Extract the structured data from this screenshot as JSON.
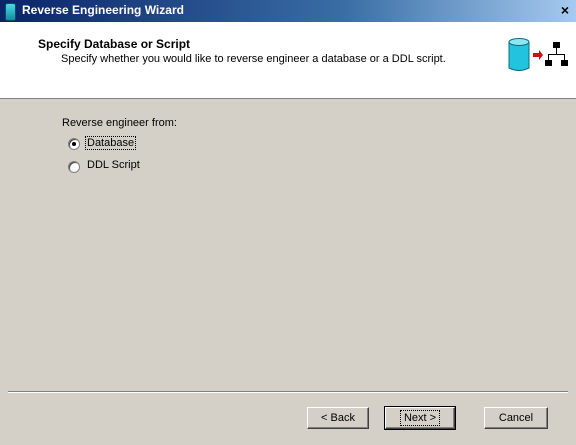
{
  "window": {
    "title": "Reverse Engineering Wizard",
    "close_glyph": "×"
  },
  "header": {
    "title": "Specify Database or Script",
    "subtitle": "Specify whether you would like to reverse engineer a database or a DDL script.",
    "icon": "database-to-diagram-icon"
  },
  "body": {
    "group_label": "Reverse engineer from:",
    "options": [
      {
        "label": "Database",
        "checked": true
      },
      {
        "label": "DDL Script",
        "checked": false
      }
    ]
  },
  "buttons": {
    "back": "< Back",
    "next": "Next >",
    "cancel": "Cancel"
  },
  "colors": {
    "titlebar_start": "#0a246a",
    "titlebar_end": "#a6caf0",
    "dialog_bg": "#d4d0c8",
    "db_cyan": "#22c4dd",
    "arrow_red": "#d01010"
  }
}
